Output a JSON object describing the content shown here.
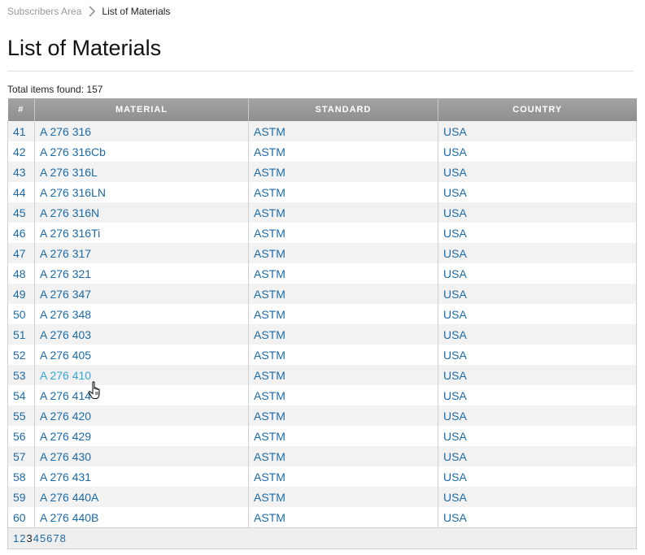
{
  "breadcrumb": {
    "parent": "Subscribers Area",
    "current": "List of Materials"
  },
  "page_title": "List of Materials",
  "total": {
    "label": "Total items found:",
    "count": "157"
  },
  "columns": [
    "#",
    "MATERIAL",
    "STANDARD",
    "COUNTRY"
  ],
  "rows": [
    {
      "num": "41",
      "material": "A 276 316",
      "standard": "ASTM",
      "country": "USA"
    },
    {
      "num": "42",
      "material": "A 276 316Cb",
      "standard": "ASTM",
      "country": "USA"
    },
    {
      "num": "43",
      "material": "A 276 316L",
      "standard": "ASTM",
      "country": "USA"
    },
    {
      "num": "44",
      "material": "A 276 316LN",
      "standard": "ASTM",
      "country": "USA"
    },
    {
      "num": "45",
      "material": "A 276 316N",
      "standard": "ASTM",
      "country": "USA"
    },
    {
      "num": "46",
      "material": "A 276 316Ti",
      "standard": "ASTM",
      "country": "USA"
    },
    {
      "num": "47",
      "material": "A 276 317",
      "standard": "ASTM",
      "country": "USA"
    },
    {
      "num": "48",
      "material": "A 276 321",
      "standard": "ASTM",
      "country": "USA"
    },
    {
      "num": "49",
      "material": "A 276 347",
      "standard": "ASTM",
      "country": "USA"
    },
    {
      "num": "50",
      "material": "A 276 348",
      "standard": "ASTM",
      "country": "USA"
    },
    {
      "num": "51",
      "material": "A 276 403",
      "standard": "ASTM",
      "country": "USA"
    },
    {
      "num": "52",
      "material": "A 276 405",
      "standard": "ASTM",
      "country": "USA"
    },
    {
      "num": "53",
      "material": "A 276 410",
      "standard": "ASTM",
      "country": "USA"
    },
    {
      "num": "54",
      "material": "A 276 414",
      "standard": "ASTM",
      "country": "USA"
    },
    {
      "num": "55",
      "material": "A 276 420",
      "standard": "ASTM",
      "country": "USA"
    },
    {
      "num": "56",
      "material": "A 276 429",
      "standard": "ASTM",
      "country": "USA"
    },
    {
      "num": "57",
      "material": "A 276 430",
      "standard": "ASTM",
      "country": "USA"
    },
    {
      "num": "58",
      "material": "A 276 431",
      "standard": "ASTM",
      "country": "USA"
    },
    {
      "num": "59",
      "material": "A 276 440A",
      "standard": "ASTM",
      "country": "USA"
    },
    {
      "num": "60",
      "material": "A 276 440B",
      "standard": "ASTM",
      "country": "USA"
    }
  ],
  "pagination": {
    "pages": [
      "1",
      "2",
      "3",
      "4",
      "5",
      "6",
      "7",
      "8"
    ],
    "current": "3"
  },
  "hovered_material": "A 276 410",
  "colors": {
    "link": "#1b6aa8",
    "link_hover": "#33a6d6",
    "header_bg": "#999999",
    "zebra": "#f2f2f2"
  }
}
